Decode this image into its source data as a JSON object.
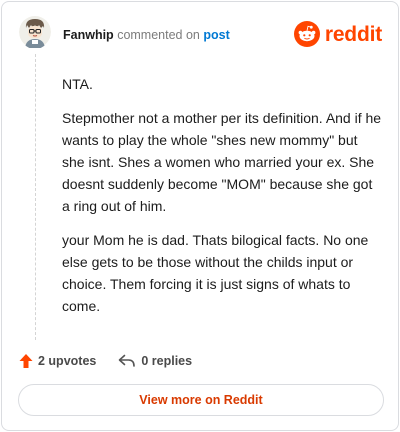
{
  "header": {
    "username": "Fanwhip",
    "action": "commented on",
    "post_link": "post",
    "brand": "reddit"
  },
  "comment": {
    "paragraphs": [
      "NTA.",
      "Stepmother not a mother per its definition. And if he wants to play the whole \"shes new mommy\" but she isnt. Shes a women who married your ex. She doesnt suddenly become \"MOM\" because she got a ring out of him.",
      "your Mom he is dad. Thats bilogical facts. No one else gets to be those without the childs input or choice. Them forcing it is just signs of whats to come."
    ]
  },
  "footer": {
    "upvotes": "2 upvotes",
    "replies": "0 replies"
  },
  "cta": {
    "label": "View more on Reddit"
  },
  "colors": {
    "brand": "#ff4500",
    "link": "#0079d3",
    "cta": "#d93a00"
  },
  "icons": [
    "avatar",
    "reddit-snoo-icon",
    "upvote-arrow-icon",
    "reply-arrow-icon"
  ]
}
